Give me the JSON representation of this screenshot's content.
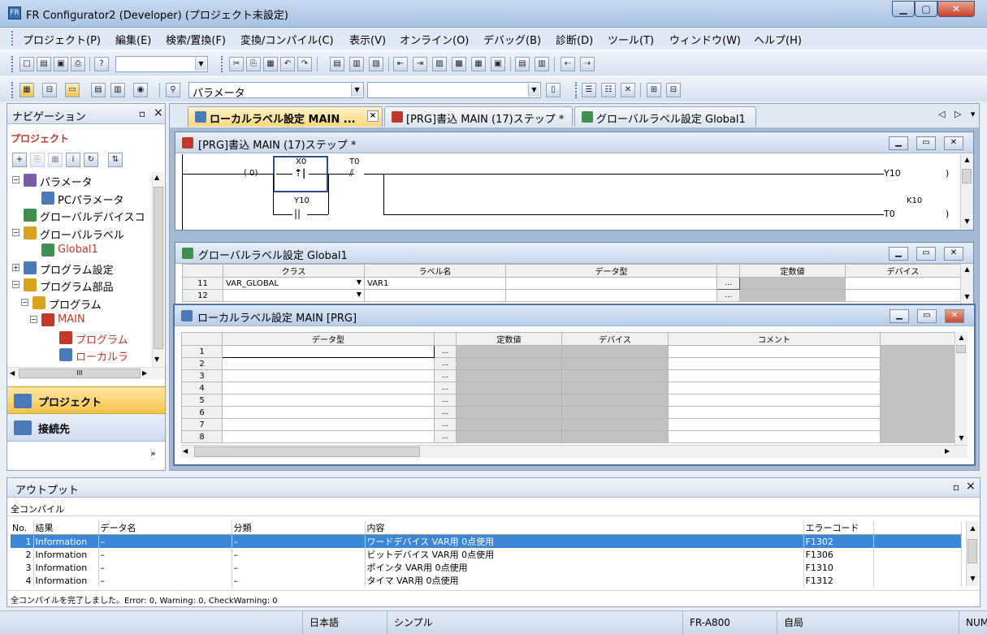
{
  "window": {
    "title": "FR Configurator2 (Developer) (プロジェクト未設定)",
    "app_icon": "FR"
  },
  "menu": [
    "プロジェクト(P)",
    "編集(E)",
    "検索/置換(F)",
    "変換/コンパイル(C)",
    "表示(V)",
    "オンライン(O)",
    "デバッグ(B)",
    "診断(D)",
    "ツール(T)",
    "ウィンドウ(W)",
    "ヘルプ(H)"
  ],
  "toolbar": {
    "param_combo": "パラメータ"
  },
  "navigation": {
    "title": "ナビゲーション",
    "pin": "᛫ ×",
    "section": "プロジェクト",
    "tree": [
      {
        "label": "パラメータ",
        "level": 0,
        "expander": "−",
        "red": false
      },
      {
        "label": "PCパラメータ",
        "level": 2,
        "expander": "",
        "red": false
      },
      {
        "label": "グローバルデバイスコ",
        "level": 0,
        "expander": "",
        "red": false
      },
      {
        "label": "グローバルラベル",
        "level": 0,
        "expander": "−",
        "red": false
      },
      {
        "label": "Global1",
        "level": 2,
        "expander": "",
        "red": true
      },
      {
        "label": "プログラム設定",
        "level": 0,
        "expander": "+",
        "red": false
      },
      {
        "label": "プログラム部品",
        "level": 0,
        "expander": "−",
        "red": false
      },
      {
        "label": "プログラム",
        "level": 1,
        "expander": "−",
        "red": false
      },
      {
        "label": "MAIN",
        "level": 2,
        "expander": "−",
        "red": true
      },
      {
        "label": "プログラム",
        "level": 4,
        "expander": "",
        "red": true
      },
      {
        "label": "ローカルラ",
        "level": 4,
        "expander": "",
        "red": true
      }
    ],
    "hscroll_grip": "III",
    "buttons": {
      "project": "プロジェクト",
      "connection": "接続先"
    },
    "chevron": "»"
  },
  "tabs": [
    {
      "label": "ローカルラベル設定 MAIN ...",
      "active": true
    },
    {
      "label": "[PRG]書込 MAIN (17)ステップ *",
      "active": false
    },
    {
      "label": "グローバルラベル設定 Global1",
      "active": false
    }
  ],
  "tab_nav": "◁ ▷ ▾",
  "ladder_window": {
    "title": "[PRG]書込 MAIN (17)ステップ *",
    "step": "(    0)",
    "contacts": {
      "x0": "X0",
      "t0": "T0",
      "y10_contact": "Y10"
    },
    "coils": {
      "y10": "Y10",
      "t0": "T0",
      "k10": "K10"
    }
  },
  "global_window": {
    "title": "グローバルラベル設定 Global1",
    "headers": [
      "クラス",
      "ラベル名",
      "データ型",
      "",
      "定数値",
      "デバイス"
    ],
    "rows": [
      {
        "n": "11",
        "class": "VAR_GLOBAL",
        "label": "VAR1"
      },
      {
        "n": "12",
        "class": "",
        "label": ""
      }
    ]
  },
  "local_window": {
    "title": "ローカルラベル設定 MAIN [PRG]",
    "headers": [
      "データ型",
      "",
      "定数値",
      "デバイス",
      "コメント"
    ],
    "rows": [
      "1",
      "2",
      "3",
      "4",
      "5",
      "6",
      "7",
      "8"
    ],
    "dots": "..."
  },
  "output": {
    "title": "アウトプット",
    "subtitle": "全コンパイル",
    "headers": [
      "No.",
      "結果",
      "データ名",
      "分類",
      "内容",
      "エラーコード"
    ],
    "rows": [
      {
        "no": "1",
        "result": "Information",
        "data": "–",
        "cat": "–",
        "content": "ワードデバイス VAR用 0点使用",
        "code": "F1302"
      },
      {
        "no": "2",
        "result": "Information",
        "data": "–",
        "cat": "–",
        "content": "ビットデバイス VAR用 0点使用",
        "code": "F1306"
      },
      {
        "no": "3",
        "result": "Information",
        "data": "–",
        "cat": "–",
        "content": "ポインタ VAR用 0点使用",
        "code": "F1310"
      },
      {
        "no": "4",
        "result": "Information",
        "data": "–",
        "cat": "–",
        "content": "タイマ VAR用 0点使用",
        "code": "F1312"
      }
    ],
    "status": "全コンパイルを完了しました。Error: 0, Warning: 0, CheckWarning: 0"
  },
  "statusbar": [
    "日本語",
    "シンプル",
    "FR-A800",
    "自局",
    "NUM"
  ]
}
